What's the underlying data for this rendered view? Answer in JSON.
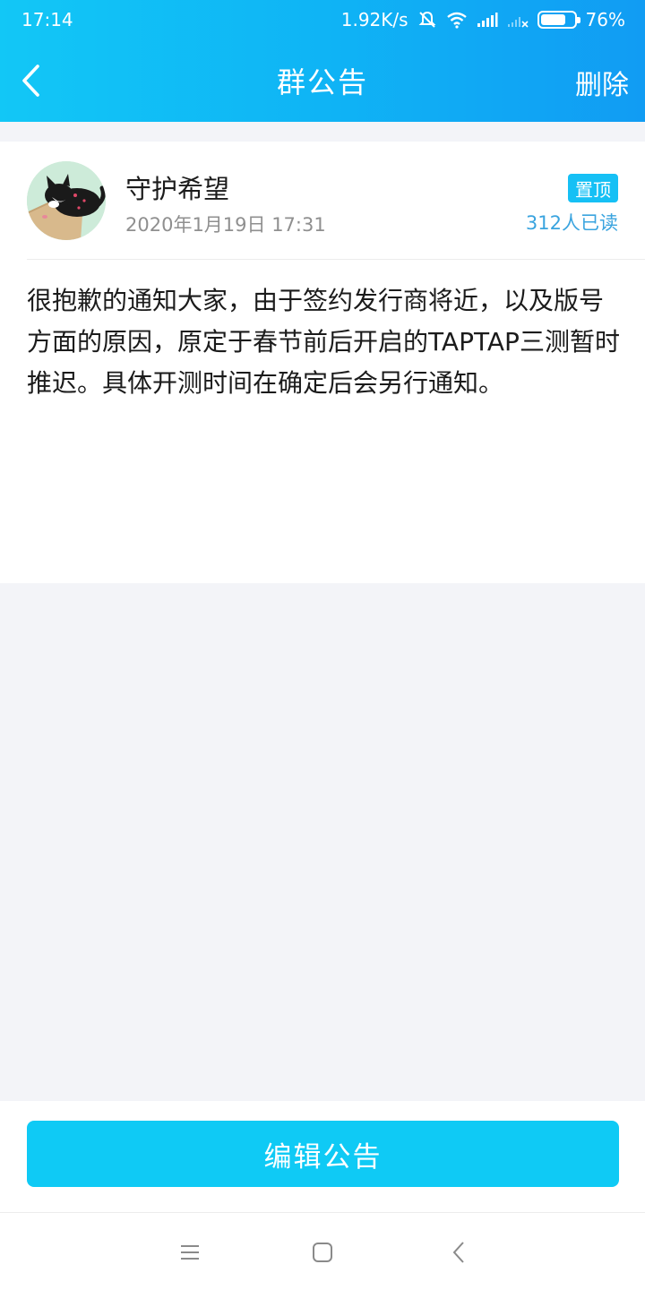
{
  "status_bar": {
    "time": "17:14",
    "network_speed": "1.92K/s",
    "battery_percent": "76%",
    "battery_level": 0.76,
    "icons": [
      "mute-icon",
      "wifi-icon",
      "signal-icon",
      "no-signal-icon",
      "battery-icon"
    ]
  },
  "header": {
    "title": "群公告",
    "delete_label": "删除",
    "back_icon": "back-arrow-icon"
  },
  "announcement": {
    "author_name": "守护希望",
    "timestamp": "2020年1月19日 17:31",
    "pin_badge": "置顶",
    "read_count": "312人已读",
    "body": "很抱歉的通知大家，由于签约发行商将近，以及版号方面的原因，原定于春节前后开启的TAPTAP三测暂时推迟。具体开测时间在确定后会另行通知。"
  },
  "footer": {
    "edit_label": "编辑公告"
  },
  "nav_bar": {
    "icons": [
      "menu-icon",
      "home-icon",
      "back-icon"
    ]
  },
  "colors": {
    "header_start": "#12c7f6",
    "header_end": "#119cf3",
    "accent": "#0fcaf5",
    "read_count": "#3aa4df",
    "background": "#f3f4f8"
  }
}
